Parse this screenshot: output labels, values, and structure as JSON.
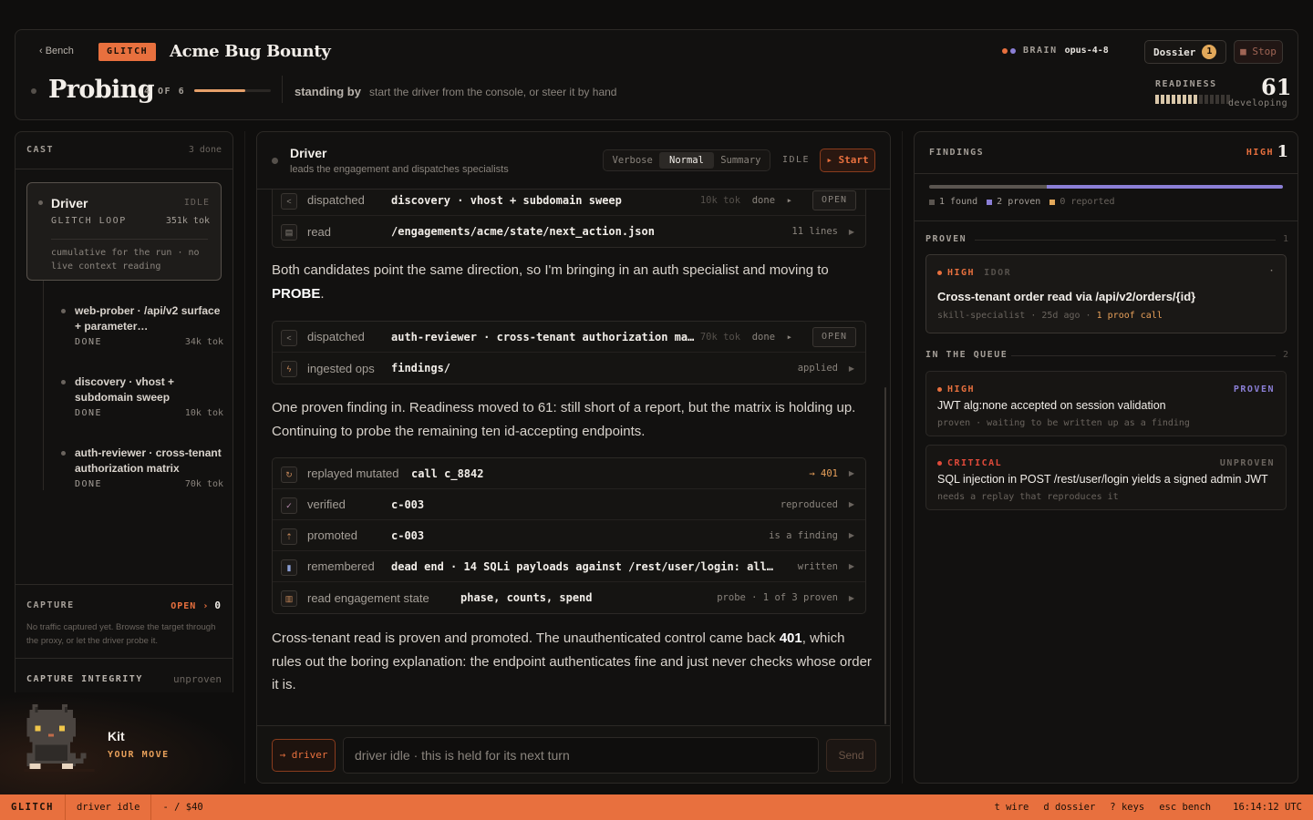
{
  "header": {
    "back_label": "‹ Bench",
    "badge": "GLITCH",
    "title": "Acme Bug Bounty",
    "brain_label": "BRAIN",
    "brain_model": "opus-4-8",
    "brain_dot_colors": [
      "#e8703e",
      "#8b7fd6"
    ],
    "dossier_label": "Dossier",
    "dossier_count": "1",
    "stop_label": "■ Stop",
    "phase": "Probing",
    "phase_count": "4 OF 6",
    "phase_progress": 0.67,
    "standing": "standing by",
    "standing_hint": "start the driver from the console, or steer it by hand",
    "readiness_label": "READINESS",
    "readiness_value": "61",
    "readiness_sub": "developing",
    "readiness_ticks_total": 14,
    "readiness_ticks_on": 8
  },
  "cast": {
    "title": "CAST",
    "done": "3 done",
    "driver": {
      "name": "Driver",
      "state": "IDLE",
      "role": "GLITCH LOOP",
      "tokens": "351k tok",
      "context_note": "cumulative for the run · no live context reading"
    },
    "agents": [
      {
        "name": "web-prober · /api/v2 surface + parameter…",
        "status": "DONE",
        "tokens": "34k tok"
      },
      {
        "name": "discovery · vhost + subdomain sweep",
        "status": "DONE",
        "tokens": "10k tok"
      },
      {
        "name": "auth-reviewer · cross-tenant authorization matrix",
        "status": "DONE",
        "tokens": "70k tok"
      }
    ],
    "capture_label": "CAPTURE",
    "capture_open": "OPEN ›",
    "capture_count": "0",
    "capture_note": "No traffic captured yet. Browse the target through the proxy, or let the driver probe it.",
    "integrity_label": "CAPTURE INTEGRITY",
    "integrity_value": "unproven"
  },
  "kit": {
    "name": "Kit",
    "move": "YOUR MOVE"
  },
  "center": {
    "title": "Driver",
    "subtitle": "leads the engagement and dispatches specialists",
    "modes": [
      "Verbose",
      "Normal",
      "Summary"
    ],
    "active_mode": "Normal",
    "state": "IDLE",
    "start_label": "▸ Start",
    "group1": [
      {
        "icon": "share-icon",
        "verb": "dispatched",
        "arg": "discovery · vhost + subdomain sweep",
        "meta_tok": "10k tok",
        "meta": "done",
        "open": "OPEN"
      },
      {
        "icon": "file-icon",
        "verb": "read",
        "arg": "/engagements/acme/state/next_action.json",
        "meta": "11 lines"
      }
    ],
    "prose1": "Both candidates point the same direction, so I'm bringing in an auth specialist and moving to",
    "prose1_bold": "PROBE",
    "prose1_end": ".",
    "group2": [
      {
        "icon": "share-icon",
        "verb": "dispatched",
        "arg": "auth-reviewer · cross-tenant authorization ma…",
        "meta_tok": "70k tok",
        "meta": "done",
        "open": "OPEN"
      },
      {
        "icon": "bolt-icon",
        "verb": "ingested ops",
        "arg": "findings/",
        "meta": "applied"
      }
    ],
    "prose2": "One proven finding in. Readiness moved to 61: still short of a report, but the matrix is holding up. Continuing to probe the remaining ten id-accepting endpoints.",
    "group3": [
      {
        "icon": "replay-icon",
        "verb": "replayed mutated",
        "arg": "call c_8842",
        "meta": "→ 401"
      },
      {
        "icon": "check-circle-icon",
        "verb": "verified",
        "arg": "c-003",
        "meta": "reproduced"
      },
      {
        "icon": "upload-icon",
        "verb": "promoted",
        "arg": "c-003",
        "meta": "is a finding"
      },
      {
        "icon": "bookmark-icon",
        "verb": "remembered",
        "arg": "dead end · 14 SQLi payloads against /rest/user/login: all…",
        "meta": "written"
      },
      {
        "icon": "bar-chart-icon",
        "verb": "read engagement state",
        "arg": "phase, counts, spend",
        "meta": "probe · 1 of 3 proven"
      }
    ],
    "prose3_a": "Cross-tenant read is proven and promoted. The unauthenticated control came back",
    "prose3_bold": "401",
    "prose3_b": ", which rules out the boring explanation: the endpoint authenticates fine and just never checks whose order it is.",
    "composer_target": "→ driver",
    "composer_placeholder": "driver idle · this is held for its next turn",
    "send_label": "Send"
  },
  "findings": {
    "title": "FINDINGS",
    "severity": "HIGH",
    "severity_count": "1",
    "bar": {
      "found": 1,
      "proven": 2,
      "reported": 0
    },
    "bar_colors": {
      "found": "#5a5550",
      "proven": "#8b7fd6",
      "reported": "#e2a85a"
    },
    "legend": [
      "1 found",
      "2 proven",
      "0 reported"
    ],
    "proven_label": "PROVEN",
    "proven_count": "1",
    "proven_cards": [
      {
        "severity": "HIGH",
        "tag": "IDOR",
        "title": "Cross-tenant order read via /api/v2/orders/{id}",
        "meta_a": "skill-specialist · 25d ago ·",
        "meta_b": "1 proof call"
      }
    ],
    "queue_label": "IN THE QUEUE",
    "queue_count": "2",
    "queue_cards": [
      {
        "severity": "HIGH",
        "status": "PROVEN",
        "title": "JWT alg:none accepted on session validation",
        "sub": "proven · waiting to be written up as a finding"
      },
      {
        "severity": "CRITICAL",
        "status": "UNPROVEN",
        "title": "SQL injection in POST /rest/user/login yields a signed admin JWT",
        "sub": "needs a replay that reproduces it"
      }
    ]
  },
  "statusbar": {
    "app": "GLITCH",
    "driver_state": "driver idle",
    "spend": "- / $40",
    "shortcuts": [
      "t wire",
      "d dossier",
      "? keys",
      "esc bench"
    ],
    "clock": "16:14:12 UTC"
  }
}
